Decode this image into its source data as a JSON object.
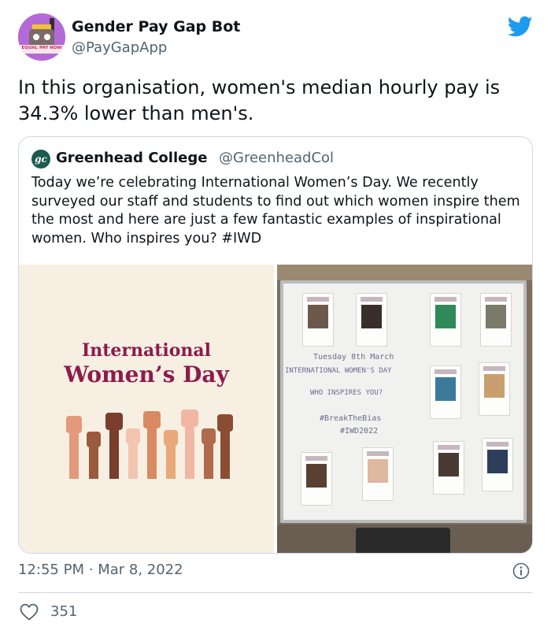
{
  "author": {
    "name": "Gender Pay Gap Bot",
    "handle": "@PayGapApp",
    "avatar_icon": "robot-avatar-icon",
    "avatar_banner": "EQUAL PAY NOW"
  },
  "tweet": {
    "text": "In this organisation, women's median hourly pay is 34.3% lower than men's."
  },
  "quoted": {
    "logo_text": "gc",
    "name": "Greenhead College",
    "handle": "@GreenheadCol",
    "text": "Today we’re celebrating International Women’s Day. We recently surveyed our staff and students to find out which women inspire them the most and here are just a few fantastic examples of inspirational women. Who inspires you? #IWD",
    "media": {
      "graphic_line1": "International",
      "graphic_line2": "Women’s Day",
      "board_date": "Tuesday 8th March",
      "board_title": "INTERNATIONAL WOMEN'S DAY",
      "board_question": "WHO INSPIRES YOU?",
      "board_tag1": "#BreakTheBias",
      "board_tag2": "#IWD2022"
    }
  },
  "footer": {
    "time": "12:55 PM",
    "separator": "·",
    "date": "Mar 8, 2022",
    "likes": "351"
  },
  "colors": {
    "twitter_blue": "#1d9bf0",
    "secondary_text": "#536471",
    "iwd_accent": "#8c1c4a"
  }
}
